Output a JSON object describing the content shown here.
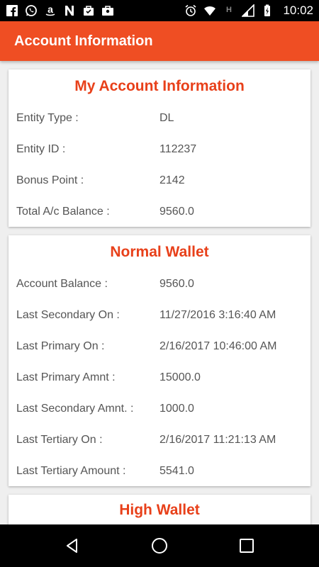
{
  "status_bar": {
    "time": "10:02",
    "left_icons": [
      "facebook-icon",
      "whatsapp-icon",
      "amazon-icon",
      "news-icon",
      "bag-icon",
      "briefcase-icon"
    ],
    "right_icons": [
      "alarm-icon",
      "wifi-icon",
      "h-signal-icon",
      "signal-icon",
      "battery-charging-icon"
    ],
    "h_label": "H"
  },
  "app_bar": {
    "title": "Account Information"
  },
  "cards": [
    {
      "title": "My Account Information",
      "rows": [
        {
          "label": "Entity Type :",
          "value": "DL"
        },
        {
          "label": "Entity ID :",
          "value": "112237"
        },
        {
          "label": "Bonus Point :",
          "value": "2142"
        },
        {
          "label": "Total A/c Balance :",
          "value": "9560.0"
        }
      ]
    },
    {
      "title": "Normal Wallet",
      "rows": [
        {
          "label": "Account Balance :",
          "value": "9560.0"
        },
        {
          "label": "Last Secondary On :",
          "value": "11/27/2016 3:16:40 AM"
        },
        {
          "label": "Last Primary On :",
          "value": "2/16/2017 10:46:00 AM"
        },
        {
          "label": "Last Primary Amnt :",
          "value": "15000.0"
        },
        {
          "label": "Last Secondary Amnt. :",
          "value": "1000.0"
        },
        {
          "label": "Last Tertiary On :",
          "value": "2/16/2017 11:21:13 AM"
        },
        {
          "label": "Last Tertiary Amount :",
          "value": "5541.0"
        }
      ]
    },
    {
      "title": "High Wallet",
      "rows": []
    }
  ],
  "nav_bar": {
    "buttons": [
      "back-icon",
      "home-icon",
      "recents-icon"
    ]
  },
  "colors": {
    "app_bar": "#ef4e23",
    "card_title": "#e8401a",
    "status_bar": "#000000"
  }
}
